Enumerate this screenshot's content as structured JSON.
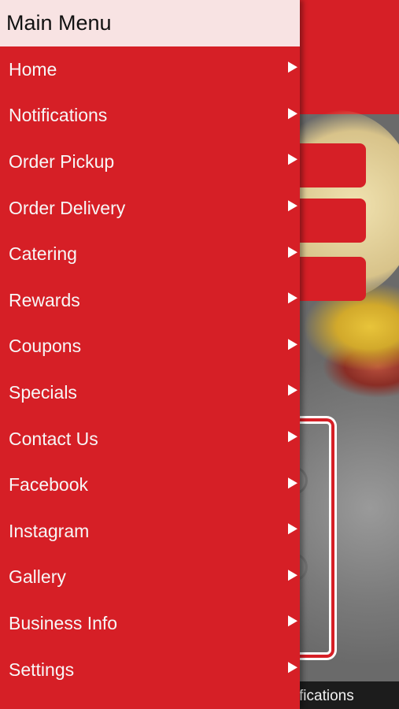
{
  "drawer": {
    "title": "Main Menu",
    "items": [
      {
        "label": "Home",
        "icon": "arrow-right-icon"
      },
      {
        "label": "Notifications",
        "icon": "arrow-right-icon"
      },
      {
        "label": "Order Pickup",
        "icon": "arrow-right-icon"
      },
      {
        "label": "Order Delivery",
        "icon": "arrow-right-icon"
      },
      {
        "label": "Catering",
        "icon": "arrow-right-icon"
      },
      {
        "label": "Rewards",
        "icon": "arrow-right-icon"
      },
      {
        "label": "Coupons",
        "icon": "arrow-right-icon"
      },
      {
        "label": "Specials",
        "icon": "arrow-right-icon"
      },
      {
        "label": "Contact Us",
        "icon": "arrow-right-icon"
      },
      {
        "label": "Facebook",
        "icon": "arrow-right-icon"
      },
      {
        "label": "Instagram",
        "icon": "arrow-right-icon"
      },
      {
        "label": "Gallery",
        "icon": "arrow-right-icon"
      },
      {
        "label": "Business Info",
        "icon": "arrow-right-icon"
      },
      {
        "label": "Settings",
        "icon": "arrow-right-icon"
      }
    ]
  },
  "background": {
    "bottom_tab_label": "fications"
  },
  "colors": {
    "accent": "#d61f26",
    "header_bg": "#f8e3e3"
  }
}
